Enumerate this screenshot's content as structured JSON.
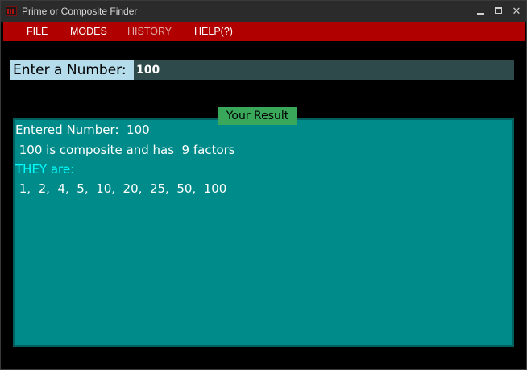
{
  "window": {
    "title": "Prime or Composite Finder",
    "minimize_glyph": "—",
    "maximize_glyph": "☐",
    "close_glyph": "✕"
  },
  "menu": {
    "items": [
      {
        "label": "FILE",
        "enabled": true
      },
      {
        "label": "MODES",
        "enabled": true
      },
      {
        "label": "HISTORY",
        "enabled": false
      },
      {
        "label": "HELP(?)",
        "enabled": true
      }
    ]
  },
  "input": {
    "label": "Enter a Number:",
    "value": "100"
  },
  "result": {
    "title": "Your Result",
    "entered_line": "Entered Number:  100",
    "composite_line": " 100 is composite and has  9 factors",
    "they_are_line": "THEY are:",
    "factors_line": " 1,  2,  4,  5,  10,  20,  25,  50,  100"
  },
  "colors": {
    "menu_bar": "#b00000",
    "label_bg": "#b4dceb",
    "input_bg": "#2f4a4a",
    "panel_bg": "#008b8b",
    "result_title_bg": "#3aa85a",
    "they_are_text": "#00ffff"
  }
}
